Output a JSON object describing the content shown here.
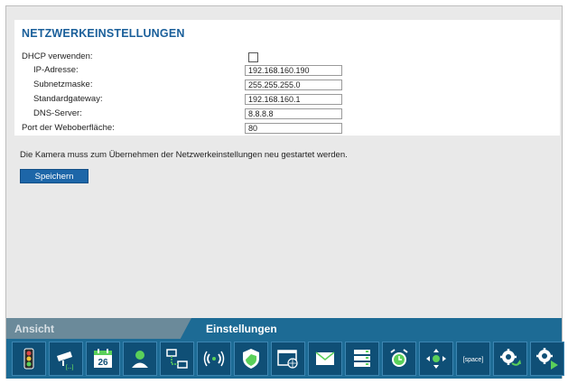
{
  "page": {
    "title": "NETZWERKEINSTELLUNGEN"
  },
  "form": {
    "dhcp_label": "DHCP verwenden:",
    "ip_label": "IP-Adresse:",
    "ip_value": "192.168.160.190",
    "subnet_label": "Subnetzmaske:",
    "subnet_value": "255.255.255.0",
    "gateway_label": "Standardgateway:",
    "gateway_value": "192.168.160.1",
    "dns_label": "DNS-Server:",
    "dns_value": "8.8.8.8",
    "port_label": "Port der Weboberfläche:",
    "port_value": "80"
  },
  "note": "Die Kamera muss zum Übernehmen der Netzwerkeinstellungen neu gestartet werden.",
  "save_label": "Speichern",
  "tabs": {
    "ansicht": "Ansicht",
    "einstellungen": "Einstellungen"
  },
  "toolbar": {
    "calendar_day": "26",
    "space_label": "[space]",
    "items": [
      "traffic-light-icon",
      "camera-icon",
      "calendar-icon",
      "user-icon",
      "network-icon",
      "wireless-icon",
      "shield-icon",
      "web-icon",
      "mail-icon",
      "storage-icon",
      "alarm-clock-icon",
      "pan-tilt-icon",
      "space-icon",
      "settings-update-icon",
      "settings-play-icon"
    ]
  }
}
